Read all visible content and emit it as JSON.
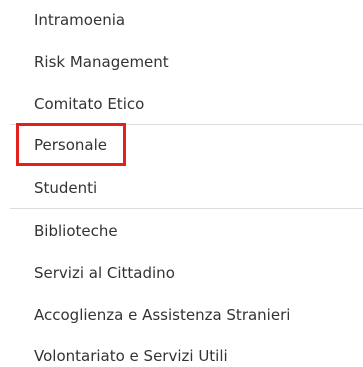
{
  "menu": {
    "items": [
      {
        "label": "Intramoenia"
      },
      {
        "label": "Risk Management"
      },
      {
        "label": "Comitato Etico"
      },
      {
        "label": "Personale"
      },
      {
        "label": "Studenti"
      },
      {
        "label": "Biblioteche"
      },
      {
        "label": "Servizi al Cittadino"
      },
      {
        "label": "Accoglienza e Assistenza Stranieri"
      },
      {
        "label": "Volontariato e Servizi Utili"
      }
    ],
    "highlighted_item": "Personale",
    "highlight_color": "#e2201c",
    "text_color": "#333333",
    "divider_color": "#dddddd"
  }
}
